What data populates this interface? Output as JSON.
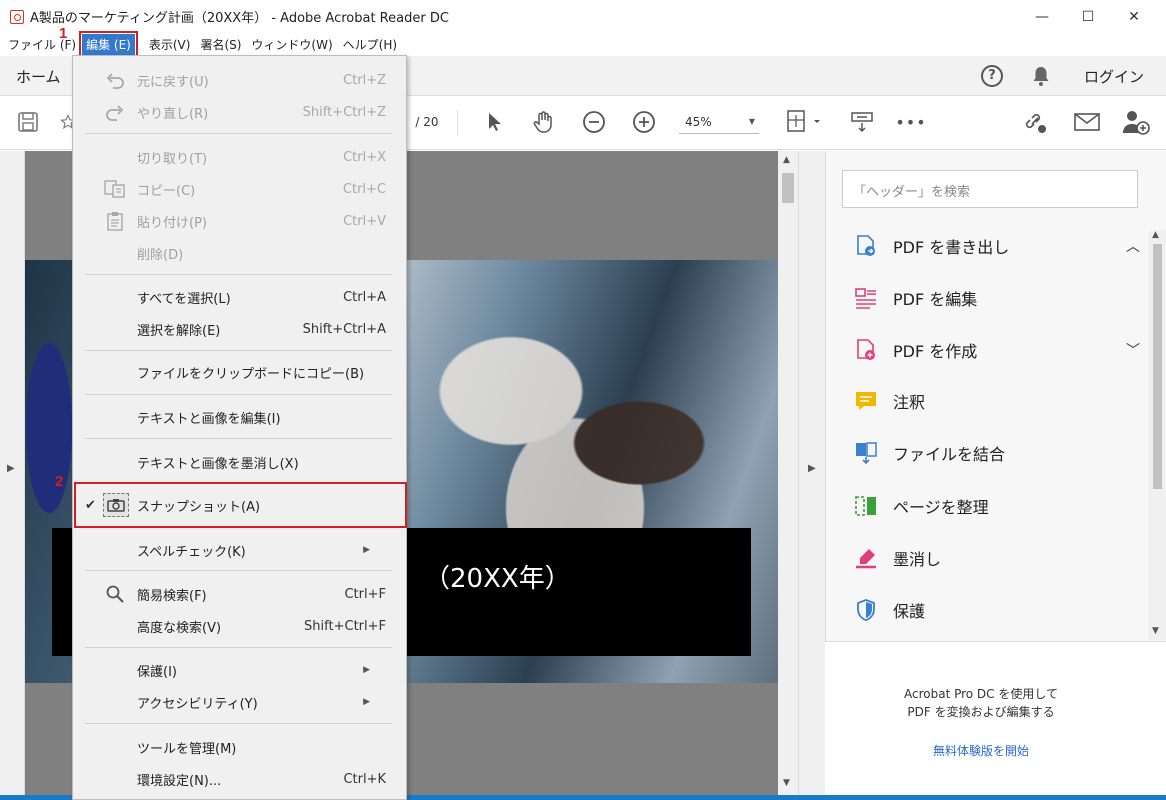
{
  "window": {
    "title": "A製品のマーケティング計画（20XX年） - Adobe Acrobat Reader DC",
    "minimize": "—",
    "maximize": "☐",
    "close": "✕"
  },
  "menubar": {
    "items": [
      "ファイル (F)",
      "編集 (E)",
      "表示(V)",
      "署名(S)",
      "ウィンドウ(W)",
      "ヘルプ(H)"
    ]
  },
  "tabbar": {
    "home": "ホーム",
    "login": "ログイン"
  },
  "toolbar": {
    "page_total": "/ 20",
    "zoom": "45%"
  },
  "document": {
    "banner_text": "（20XX年）"
  },
  "edit_menu": {
    "undo": {
      "label": "元に戻す(U)",
      "shortcut": "Ctrl+Z"
    },
    "redo": {
      "label": "やり直し(R)",
      "shortcut": "Shift+Ctrl+Z"
    },
    "cut": {
      "label": "切り取り(T)",
      "shortcut": "Ctrl+X"
    },
    "copy": {
      "label": "コピー(C)",
      "shortcut": "Ctrl+C"
    },
    "paste": {
      "label": "貼り付け(P)",
      "shortcut": "Ctrl+V"
    },
    "delete": {
      "label": "削除(D)"
    },
    "select_all": {
      "label": "すべてを選択(L)",
      "shortcut": "Ctrl+A"
    },
    "deselect": {
      "label": "選択を解除(E)",
      "shortcut": "Shift+Ctrl+A"
    },
    "copy_clipboard": {
      "label": "ファイルをクリップボードにコピー(B)"
    },
    "edit_text_images": {
      "label": "テキストと画像を編集(I)"
    },
    "redact_text_images": {
      "label": "テキストと画像を墨消し(X)"
    },
    "snapshot": {
      "label": "スナップショット(A)"
    },
    "spellcheck": {
      "label": "スペルチェック(K)"
    },
    "find": {
      "label": "簡易検索(F)",
      "shortcut": "Ctrl+F"
    },
    "advanced_search": {
      "label": "高度な検索(V)",
      "shortcut": "Shift+Ctrl+F"
    },
    "protection": {
      "label": "保護(I)"
    },
    "accessibility": {
      "label": "アクセシビリティ(Y)"
    },
    "manage_tools": {
      "label": "ツールを管理(M)"
    },
    "preferences": {
      "label": "環境設定(N)...",
      "shortcut": "Ctrl+K"
    }
  },
  "right_pane": {
    "search_placeholder": "「ヘッダー」を検索",
    "tools": [
      {
        "label": "PDF を書き出し",
        "icon": "export-pdf-icon",
        "color": "#3a7fd0"
      },
      {
        "label": "PDF を編集",
        "icon": "edit-pdf-icon",
        "color": "#e0407a"
      },
      {
        "label": "PDF を作成",
        "icon": "create-pdf-icon",
        "color": "#e0407a"
      },
      {
        "label": "注釈",
        "icon": "comment-icon",
        "color": "#f2b600"
      },
      {
        "label": "ファイルを結合",
        "icon": "combine-files-icon",
        "color": "#3a7fd0"
      },
      {
        "label": "ページを整理",
        "icon": "organize-pages-icon",
        "color": "#3aa03a"
      },
      {
        "label": "墨消し",
        "icon": "redact-icon",
        "color": "#e0407a"
      },
      {
        "label": "保護",
        "icon": "protect-icon",
        "color": "#3a7fd0"
      }
    ],
    "promo_line1": "Acrobat Pro DC を使用して",
    "promo_line2": "PDF を変換および編集する",
    "promo_link": "無料体験版を開始"
  },
  "annotations": {
    "step1": "1",
    "step2": "2"
  },
  "colors": {
    "menu_highlight": "#3478cc",
    "annotation_red": "#d21f1f",
    "link_blue": "#2a6ad2"
  }
}
